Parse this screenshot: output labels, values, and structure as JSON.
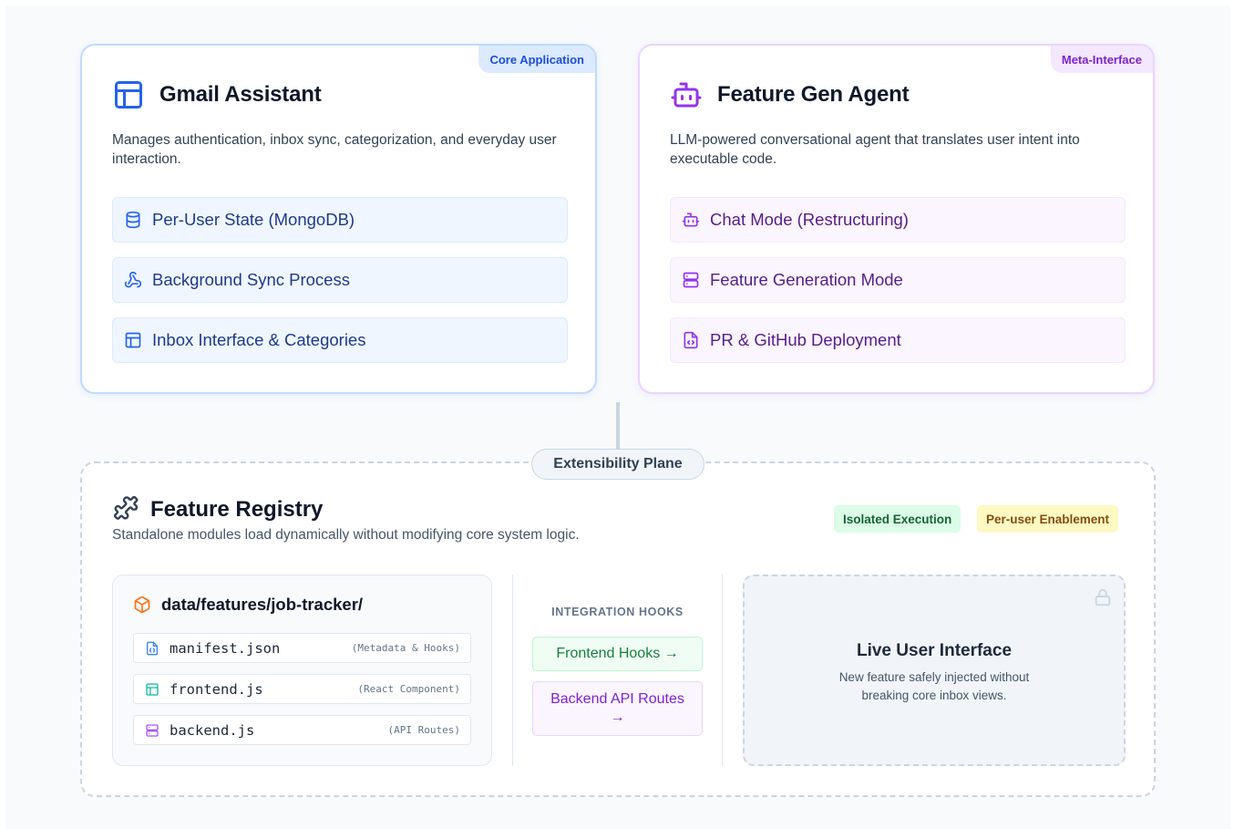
{
  "gmail_card": {
    "badge": "Core Application",
    "title": "Gmail Assistant",
    "description": "Manages authentication, inbox sync, categorization, and everyday user interaction.",
    "items": [
      {
        "label": "Per-User State (MongoDB)",
        "icon": "database-icon"
      },
      {
        "label": "Background Sync Process",
        "icon": "webhook-icon"
      },
      {
        "label": "Inbox Interface & Categories",
        "icon": "layout-icon"
      }
    ]
  },
  "agent_card": {
    "badge": "Meta-Interface",
    "title": "Feature Gen Agent",
    "description": "LLM-powered conversational agent that translates user intent into executable code.",
    "items": [
      {
        "label": "Chat Mode (Restructuring)",
        "icon": "bot-icon"
      },
      {
        "label": "Feature Generation Mode",
        "icon": "server-icon"
      },
      {
        "label": "PR & GitHub Deployment",
        "icon": "file-code-icon"
      }
    ]
  },
  "extensibility": {
    "plane_label": "Extensibility Plane",
    "title": "Feature Registry",
    "description": "Standalone modules load dynamically without modifying core system logic.",
    "tags": [
      "Isolated Execution",
      "Per-user Enablement"
    ],
    "folder": {
      "path": "data/features/job-tracker/",
      "files": [
        {
          "name": "manifest.json",
          "note": "(Metadata & Hooks)",
          "icon": "file-json-icon"
        },
        {
          "name": "frontend.js",
          "note": "(React Component)",
          "icon": "component-icon"
        },
        {
          "name": "backend.js",
          "note": "(API Routes)",
          "icon": "server-icon"
        }
      ]
    },
    "hooks": {
      "label": "INTEGRATION HOOKS",
      "frontend": "Frontend Hooks →",
      "backend": "Backend API Routes →"
    },
    "live": {
      "title": "Live User Interface",
      "description": "New feature safely injected without breaking core inbox views."
    }
  },
  "colors": {
    "core_blue": "#1d4ed8",
    "meta_purple": "#7e22ce",
    "hook_green": "#15803d",
    "folder_orange": "#f97316"
  }
}
